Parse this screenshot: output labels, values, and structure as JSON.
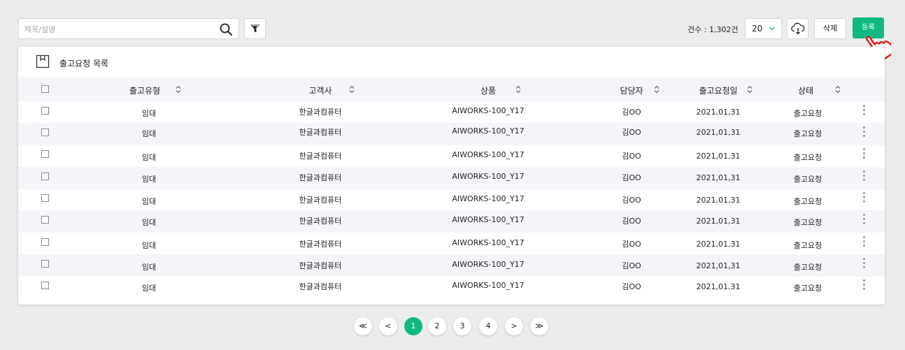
{
  "toolbar": {
    "search_placeholder": "제목/설명",
    "count_label": "건수 : 1,302건",
    "page_size": "20",
    "delete_label": "삭제",
    "register_label": "등록"
  },
  "card": {
    "title": "출고요청 목록"
  },
  "table": {
    "columns": [
      "출고유형",
      "고객사",
      "상품",
      "담당자",
      "출고요청일",
      "상태"
    ],
    "rows": [
      {
        "type": "임대",
        "customer": "한글과컴퓨터",
        "product": "AIWORKS-100_Y17",
        "manager": "김OO",
        "date": "2021,01,31",
        "status": "출고요청"
      },
      {
        "type": "임대",
        "customer": "한글과컴퓨터",
        "product": "AIWORKS-100_Y17",
        "manager": "김OO",
        "date": "2021,01,31",
        "status": "출고요청"
      },
      {
        "type": "임대",
        "customer": "한글과컴퓨터",
        "product": "AIWORKS-100_Y17",
        "manager": "김OO",
        "date": "2021,01,31",
        "status": "출고요청"
      },
      {
        "type": "임대",
        "customer": "한글과컴퓨터",
        "product": "AIWORKS-100_Y17",
        "manager": "김OO",
        "date": "2021,01,31",
        "status": "출고요청"
      },
      {
        "type": "임대",
        "customer": "한글과컴퓨터",
        "product": "AIWORKS-100_Y17",
        "manager": "김OO",
        "date": "2021,01,31",
        "status": "출고요청"
      },
      {
        "type": "임대",
        "customer": "한글과컴퓨터",
        "product": "AIWORKS-100_Y17",
        "manager": "김OO",
        "date": "2021,01,31",
        "status": "출고요청"
      },
      {
        "type": "임대",
        "customer": "한글과컴퓨터",
        "product": "AIWORKS-100_Y17",
        "manager": "김OO",
        "date": "2021,01,31",
        "status": "출고요청"
      },
      {
        "type": "임대",
        "customer": "한글과컴퓨터",
        "product": "AIWORKS-100_Y17",
        "manager": "김OO",
        "date": "2021,01,31",
        "status": "출고요청"
      },
      {
        "type": "임대",
        "customer": "한글과컴퓨터",
        "product": "AIWORKS-100_Y17",
        "manager": "김OO",
        "date": "2021,01,31",
        "status": "출고요청"
      }
    ]
  },
  "pagination": {
    "first": "≪",
    "prev": "<",
    "pages": [
      "1",
      "2",
      "3",
      "4"
    ],
    "current": "1",
    "next": ">",
    "last": "≫"
  },
  "colors": {
    "accent": "#10b981",
    "row_alt": "#f4f5f9"
  },
  "icons": [
    "search-icon",
    "filter-icon",
    "chevron-down-icon",
    "cloud-download-icon",
    "box-icon",
    "sort-icon",
    "more-vertical-icon",
    "pointer-cursor-icon"
  ]
}
